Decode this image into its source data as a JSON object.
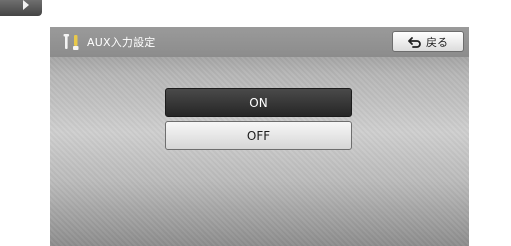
{
  "header": {
    "title": "AUX入力設定",
    "icon": "wrench-icon",
    "back_label": "戻る",
    "back_icon": "return-arrow-icon"
  },
  "options": {
    "on_label": "ON",
    "off_label": "OFF",
    "selected": "ON"
  },
  "colors": {
    "selected_button": "#2f2f2f",
    "unselected_button": "#e8e8e8",
    "header_bar": "#939393"
  }
}
